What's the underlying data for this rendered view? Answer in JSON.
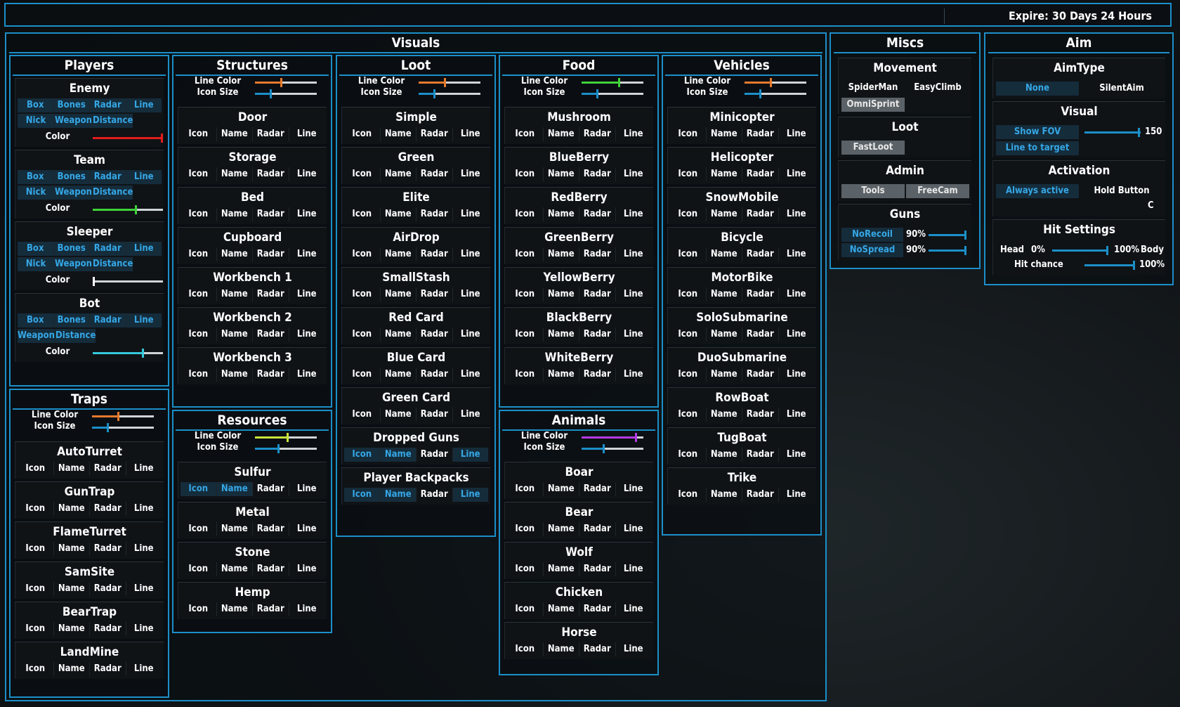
{
  "topbar": {
    "expire": "Expire: 30 Days 24 Hours"
  },
  "sections": {
    "visuals": "Visuals",
    "miscs": "Miscs",
    "aim": "Aim"
  },
  "btn": {
    "box": "Box",
    "bones": "Bones",
    "radar": "Radar",
    "line": "Line",
    "nick": "Nick",
    "weapon": "Weapon",
    "distance": "Distance",
    "icon": "Icon",
    "name": "Name"
  },
  "labels": {
    "color": "Color",
    "line_color": "Line Color",
    "icon_size": "Icon Size"
  },
  "players": {
    "title": "Players",
    "enemy": "Enemy",
    "team": "Team",
    "sleeper": "Sleeper",
    "bot": "Bot",
    "colors": {
      "enemy": "#e21d1d",
      "team": "#3fd23a",
      "sleeper": "#ffffff",
      "bot": "#36c7dc"
    },
    "levels": {
      "enemy": 1.0,
      "team": 0.6,
      "sleeper": 0.0,
      "bot": 0.7
    }
  },
  "traps": {
    "title": "Traps",
    "line_color": "#e57a2d",
    "line_level": 0.42,
    "icon_size_level": 0.25,
    "items": [
      "AutoTurret",
      "GunTrap",
      "FlameTurret",
      "SamSite",
      "BearTrap",
      "LandMine"
    ]
  },
  "structures": {
    "title": "Structures",
    "line_color": "#e57a2d",
    "line_level": 0.42,
    "icon_size_level": 0.25,
    "items": [
      "Door",
      "Storage",
      "Bed",
      "Cupboard",
      "Workbench 1",
      "Workbench 2",
      "Workbench 3"
    ]
  },
  "resources": {
    "title": "Resources",
    "line_color": "#c8e43a",
    "line_level": 0.52,
    "icon_size_level": 0.37,
    "items": [
      "Sulfur",
      "Metal",
      "Stone",
      "Hemp"
    ]
  },
  "loot": {
    "title": "Loot",
    "line_color": "#e57a2d",
    "line_level": 0.42,
    "icon_size_level": 0.25,
    "items": [
      "Simple",
      "Green",
      "Elite",
      "AirDrop",
      "SmallStash",
      "Red Card",
      "Blue Card",
      "Green Card",
      "Dropped Guns",
      "Player Backpacks"
    ]
  },
  "food": {
    "title": "Food",
    "line_color": "#3fd23a",
    "line_level": 0.6,
    "icon_size_level": 0.25,
    "items": [
      "Mushroom",
      "BlueBerry",
      "RedBerry",
      "GreenBerry",
      "YellowBerry",
      "BlackBerry",
      "WhiteBerry"
    ]
  },
  "animals": {
    "title": "Animals",
    "line_color": "#b13ae4",
    "line_level": 0.88,
    "icon_size_level": 0.35,
    "items": [
      "Boar",
      "Bear",
      "Wolf",
      "Chicken",
      "Horse"
    ]
  },
  "vehicles": {
    "title": "Vehicles",
    "line_color": "#e57a2d",
    "line_level": 0.42,
    "icon_size_level": 0.25,
    "items": [
      "Minicopter",
      "Helicopter",
      "SnowMobile",
      "Bicycle",
      "MotorBike",
      "SoloSubmarine",
      "DuoSubmarine",
      "RowBoat",
      "TugBoat",
      "Trike"
    ]
  },
  "miscs": {
    "movement": {
      "title": "Movement",
      "spiderman": "SpiderMan",
      "easyclimb": "EasyClimb",
      "omnisprint": "OmniSprint"
    },
    "loot": {
      "title": "Loot",
      "fastloot": "FastLoot"
    },
    "admin": {
      "title": "Admin",
      "tools": "Tools",
      "freecam": "FreeCam"
    },
    "guns": {
      "title": "Guns",
      "norecoil": "NoRecoil",
      "norecoil_value": "90%",
      "nospread": "NoSpread",
      "nospread_value": "90%",
      "norecoil_level": 0.9,
      "nospread_level": 0.9
    }
  },
  "aim": {
    "aimtype": {
      "title": "AimType",
      "none": "None",
      "silent": "SilentAim"
    },
    "visual": {
      "title": "Visual",
      "show_fov": "Show FOV",
      "fov_value": "150",
      "fov_level": 0.95,
      "line_to_target": "Line to target"
    },
    "activation": {
      "title": "Activation",
      "always": "Always active",
      "hold": "Hold Button",
      "key": "C"
    },
    "hit": {
      "title": "Hit Settings",
      "head": "Head",
      "head_pct": "0%",
      "body_pct": "100%",
      "body": "Body",
      "hit_chance": "Hit chance",
      "hit_chance_value": "100%",
      "head_body_level": 1.0,
      "hit_chance_level": 1.0
    }
  },
  "accent": "#1c8fc9",
  "active_text": "#35a7e6"
}
